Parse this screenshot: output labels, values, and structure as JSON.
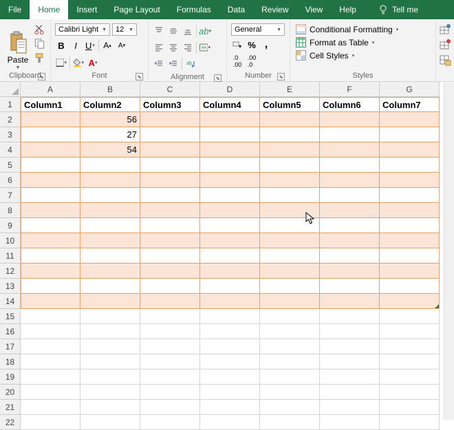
{
  "tabs": [
    "File",
    "Home",
    "Insert",
    "Page Layout",
    "Formulas",
    "Data",
    "Review",
    "View",
    "Help"
  ],
  "active_tab": "Home",
  "tellme": "Tell me",
  "groups": {
    "clipboard": {
      "label": "Clipboard",
      "paste": "Paste"
    },
    "font": {
      "label": "Font",
      "name": "Calibri Light",
      "size": "12"
    },
    "alignment": {
      "label": "Alignment"
    },
    "number": {
      "label": "Number",
      "format": "General"
    },
    "styles": {
      "label": "Styles",
      "conditional": "Conditional Formatting",
      "table": "Format as Table",
      "cell": "Cell Styles"
    }
  },
  "columns": [
    "A",
    "B",
    "C",
    "D",
    "E",
    "F",
    "G"
  ],
  "headers": [
    "Column1",
    "Column2",
    "Column3",
    "Column4",
    "Column5",
    "Column6",
    "Column7"
  ],
  "table_rows": 14,
  "total_rows": 22,
  "data": {
    "B2": "56",
    "B3": "27",
    "B4": "54"
  }
}
